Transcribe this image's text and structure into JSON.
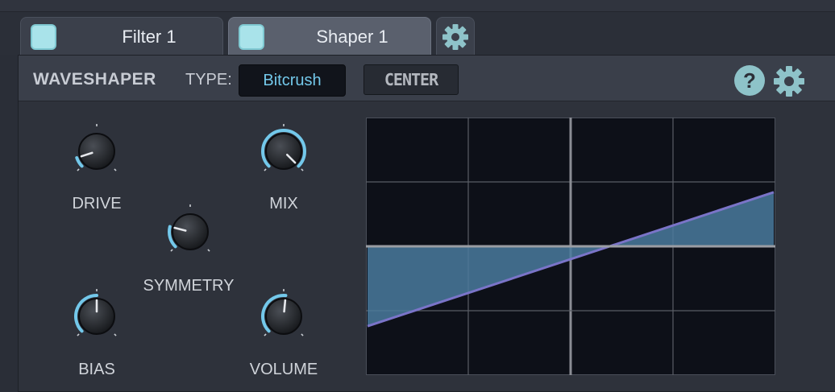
{
  "tabs": [
    {
      "label": "Filter 1",
      "active": false
    },
    {
      "label": "Shaper 1",
      "active": true
    }
  ],
  "header": {
    "title": "WAVESHAPER",
    "type_label": "TYPE:",
    "type_value": "Bitcrush",
    "center_button": "CENTER",
    "help_glyph": "?"
  },
  "knobs": {
    "drive": {
      "label": "DRIVE",
      "value": 0.1
    },
    "mix": {
      "label": "MIX",
      "value": 1.0
    },
    "symmetry": {
      "label": "SYMMETRY",
      "value": 0.22
    },
    "bias": {
      "label": "BIAS",
      "value": 0.5
    },
    "volume": {
      "label": "VOLUME",
      "value": 0.52
    }
  },
  "graph": {
    "shape": "linear",
    "x_range": [
      -1,
      1
    ],
    "y_range": [
      -1,
      1
    ],
    "curve_start_y": -0.62,
    "curve_end_y": 0.42,
    "gridlines": 4
  },
  "colors": {
    "accent": "#73c8ea",
    "toggle": "#a9e3ea",
    "curve": "#7a74c8",
    "fill": "#4a7a9e",
    "graph_bg": "#0d1018"
  },
  "icons": {
    "tab_settings": "gear-icon",
    "help": "help-icon",
    "settings": "gear-icon"
  }
}
